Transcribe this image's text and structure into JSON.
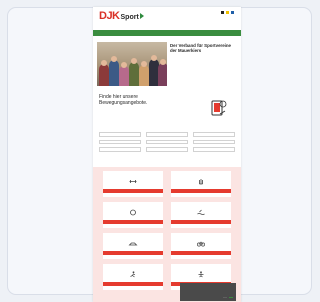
{
  "site": {
    "logo_mark": "DJK",
    "logo_word": "Sport",
    "logo_tagline": "",
    "header_links": [
      "",
      "",
      ""
    ],
    "flag_colors": [
      "#222222",
      "#f2c200",
      "#1f5fa8"
    ],
    "brand_red": "#d93025",
    "brand_green": "#3a8d3f"
  },
  "nav": {
    "items": [
      "",
      "",
      "",
      "",
      "",
      "",
      ""
    ]
  },
  "hero": {
    "title": "Der Verband für Sportvereine der Mauerkiers",
    "body": "",
    "link": ""
  },
  "find": {
    "title": "Finde hier unsere Bewegungsangebote.",
    "hint": "",
    "hint2": "",
    "filters": [
      "",
      "",
      "",
      "",
      "",
      "",
      "",
      "",
      ""
    ]
  },
  "offers": {
    "tiles": [
      {
        "tag": "",
        "label": "",
        "icon": "dumbbell-icon"
      },
      {
        "tag": "",
        "label": "",
        "icon": "hand-icon"
      },
      {
        "tag": "",
        "label": "",
        "icon": "ball-icon"
      },
      {
        "tag": "",
        "label": "",
        "icon": "swim-icon"
      },
      {
        "tag": "",
        "label": "",
        "icon": "shoe-icon"
      },
      {
        "tag": "",
        "label": "",
        "icon": "bike-icon"
      },
      {
        "tag": "",
        "label": "",
        "icon": "run-icon"
      },
      {
        "tag": "",
        "label": "",
        "icon": "yoga-icon"
      }
    ]
  },
  "cookie": {
    "text": "",
    "decline": "",
    "accept": ""
  }
}
